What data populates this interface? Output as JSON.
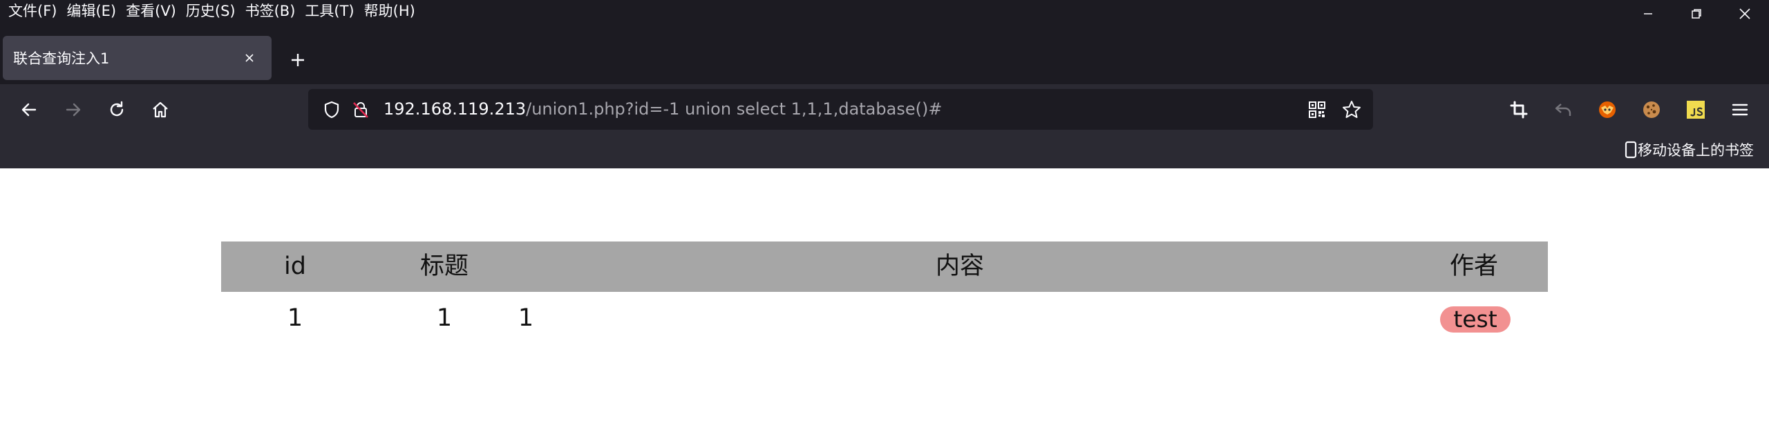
{
  "menu": {
    "items": [
      "文件(F)",
      "编辑(E)",
      "查看(V)",
      "历史(S)",
      "书签(B)",
      "工具(T)",
      "帮助(H)"
    ]
  },
  "window_controls": [
    "minimize-icon",
    "restore-icon",
    "close-icon"
  ],
  "tab": {
    "title": "联合查询注入1"
  },
  "urlbar": {
    "host": "192.168.119.213",
    "path": "/union1.php?id=-1 union select 1,1,1,database()#"
  },
  "bookmarks_bar": {
    "mobile_label": "移动设备上的书签"
  },
  "toolbar_icons": [
    "crop-icon",
    "undo-icon",
    "extension-fox-icon",
    "cookie-icon",
    "js-icon",
    "hamburger-menu-icon"
  ],
  "table": {
    "headers": [
      "id",
      "标题",
      "内容",
      "作者"
    ],
    "row": {
      "id": "1",
      "title": "1",
      "content": "1",
      "author": "test"
    }
  },
  "colors": {
    "menubar_bg": "#1c1b22",
    "tab_active_bg": "#42414d",
    "toolbar_bg": "#2b2a33",
    "table_header_bg": "#a6a6a6",
    "author_badge_bg": "#f29191"
  }
}
